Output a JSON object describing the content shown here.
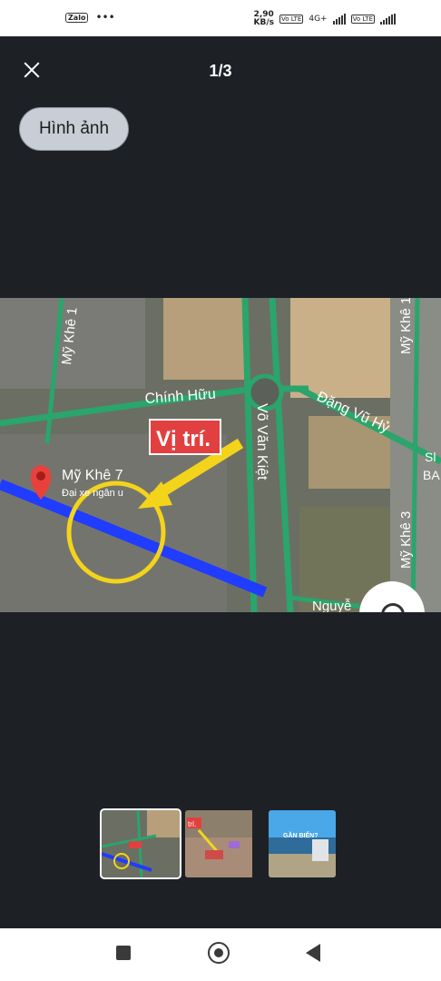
{
  "status_bar": {
    "app_icon": "Zalo",
    "more": "•••",
    "speed_value": "2,90",
    "speed_unit": "KB/s",
    "network": "4G+",
    "volte": "Vo LTE"
  },
  "header": {
    "close_icon": "close-icon",
    "counter": "1/3"
  },
  "chip": {
    "label": "Hình ảnh"
  },
  "map": {
    "roads": {
      "my_khe_1": "Mỹ Khê 1",
      "chinh_huu": "Chính Hữu",
      "dang_vu_hy": "Đặng Vũ Hỷ",
      "vo_van_kiet": "Võ Văn Kiệt",
      "my_khe_3": "Mỹ Khê 3",
      "nguy": "Nguyễ",
      "my_khe_7": "Mỹ Khê 7",
      "ngan_label": "Đại xe ngân u"
    },
    "edge_labels": {
      "si": "Sl",
      "ba": "BA"
    },
    "vitri": "Vị trí."
  },
  "thumbnails": {
    "t2_label": "trí.",
    "t3_label": "GẦN BIỂN?"
  },
  "colors": {
    "background": "#1d2126",
    "chip": "#c9ced6",
    "highlight_road": "#1f3cff",
    "marker": "#e8413b",
    "arrow": "#f3d41b"
  }
}
